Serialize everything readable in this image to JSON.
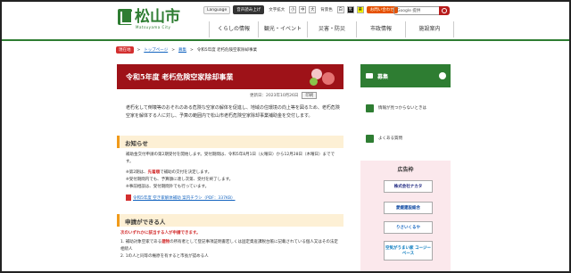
{
  "header": {
    "logo": {
      "name": "松山市",
      "sub": "Matsuyama City"
    },
    "topbar": {
      "language": "Language",
      "read_aloud": "音声読み上げ",
      "font_size": "文字拡大",
      "size_small": "小",
      "size_medium": "中",
      "size_large": "大",
      "bg_color": "背景色",
      "color_w": "白",
      "color_b": "黒",
      "color_y": "黄",
      "ask": "お問い合わせ"
    },
    "search": {
      "placeholder": "Google 提供"
    },
    "nav": [
      "くらしの情報",
      "観光・イベント",
      "災害・防災",
      "市政情報",
      "施設案内"
    ]
  },
  "breadcrumb": {
    "tag": "現在地",
    "items": [
      "トップページ",
      "募集",
      "令和5年度 老朽危険空家除却事業"
    ]
  },
  "main": {
    "title": "令和5年度 老朽危険空家除却事業",
    "updated": "更新日：2023年10月26日",
    "print": "印刷",
    "intro": "老朽化して倒壊等のおそれのある危険な空家の解体を促進し、地域の住環境の向上等を図るため、老朽危険空家を解体する人に対し、予算の範囲内で松山市老朽危険空家除却事業補助金を交付します。",
    "notice": {
      "heading": "お知らせ",
      "p1": "補助金交付申請の第2期受付を開始します。受付期間は、令和5年8月1日（火曜日）から12月28日（木曜日）までです。",
      "p2_pre": "※第2期は、",
      "p2_red": "先着順",
      "p2_post": "で補助の交付を決定します。",
      "p3": "※受付期間内でも、予算額に達し次第、受付を終了します。",
      "p4": "※事前相談は、受付期間外でも行っています。",
      "pdf": "令和5年度 空き家解体補助 案内チラシ（PDF：337KB）"
    },
    "apply": {
      "heading": "申請ができる人",
      "red_note": "次のいずれかに該当する人が申請できます。",
      "item1_pre": "1. 補助対象空家である",
      "item1_red": "建物",
      "item1_post": "の所有者として登記事項証明書若しくは固定資産課税台帳に記載されている個人又はその法定相続人",
      "item2": "2. 1の人と同等の権原を有すると市長が認める人"
    }
  },
  "side": {
    "box_title": "募集",
    "links": [
      "情報が見つからないときは",
      "よくある質問"
    ],
    "ads_title": "広告枠",
    "ads": [
      "株式会社ナカタ",
      "愛媛建設総合",
      "りさいくるや",
      "空気がうまい家 コージーベース"
    ]
  }
}
